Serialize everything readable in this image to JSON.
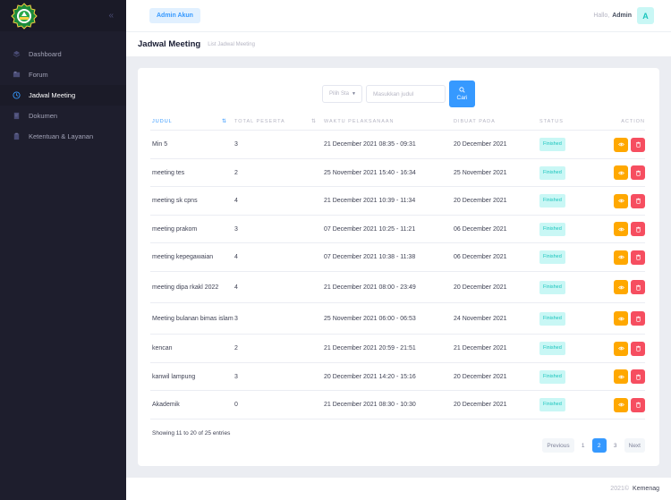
{
  "sidebar": {
    "items": [
      {
        "label": "Dashboard",
        "icon": "layers-icon"
      },
      {
        "label": "Forum",
        "icon": "forum-icon"
      },
      {
        "label": "Jadwal Meeting",
        "icon": "clock-icon",
        "active": true
      },
      {
        "label": "Dokumen",
        "icon": "document-icon"
      },
      {
        "label": "Ketentuan & Layanan",
        "icon": "clipboard-icon"
      }
    ]
  },
  "header": {
    "admin_chip": "Admin Akun",
    "greeting": "Hallo,",
    "user_name": "Admin",
    "avatar_letter": "A"
  },
  "subheader": {
    "title": "Jadwal Meeting",
    "crumb": "List Jadwal Meeting"
  },
  "filters": {
    "status_select": "Pilih Sta",
    "search_placeholder": "Masukkan judul",
    "search_button": "Cari"
  },
  "table": {
    "columns": [
      "JUDUL",
      "TOTAL PESERTA",
      "WAKTU PELAKSANAAN",
      "DIBUAT PADA",
      "STATUS",
      "ACTION"
    ],
    "rows": [
      {
        "judul": "Min 5",
        "peserta": "3",
        "waktu": "21 December 2021 08:35 - 09:31",
        "dibuat": "20 December 2021",
        "status": "Finished"
      },
      {
        "judul": "meeting tes",
        "peserta": "2",
        "waktu": "25 November 2021 15:40 - 16:34",
        "dibuat": "25 November 2021",
        "status": "Finished"
      },
      {
        "judul": "meeting sk cpns",
        "peserta": "4",
        "waktu": "21 December 2021 10:39 - 11:34",
        "dibuat": "20 December 2021",
        "status": "Finished"
      },
      {
        "judul": "meeting prakom",
        "peserta": "3",
        "waktu": "07 December 2021 10:25 - 11:21",
        "dibuat": "06 December 2021",
        "status": "Finished"
      },
      {
        "judul": "meeting kepegawaian",
        "peserta": "4",
        "waktu": "07 December 2021 10:38 - 11:38",
        "dibuat": "06 December 2021",
        "status": "Finished"
      },
      {
        "judul": "meeting dipa rkakl 2022",
        "peserta": "4",
        "waktu": "21 December 2021 08:00 - 23:49",
        "dibuat": "20 December 2021",
        "status": "Finished"
      },
      {
        "judul": "Meeting bulanan bimas islam",
        "peserta": "3",
        "waktu": "25 November 2021 06:00 - 06:53",
        "dibuat": "24 November 2021",
        "status": "Finished"
      },
      {
        "judul": "kencan",
        "peserta": "2",
        "waktu": "21 December 2021 20:59 - 21:51",
        "dibuat": "21 December 2021",
        "status": "Finished"
      },
      {
        "judul": "kanwil lampung",
        "peserta": "3",
        "waktu": "20 December 2021 14:20 - 15:16",
        "dibuat": "20 December 2021",
        "status": "Finished"
      },
      {
        "judul": "Akademik",
        "peserta": "0",
        "waktu": "21 December 2021 08:30 - 10:30",
        "dibuat": "20 December 2021",
        "status": "Finished"
      }
    ]
  },
  "entries_info": "Showing 11 to 20 of 25 entries",
  "pagination": {
    "previous": "Previous",
    "pages": [
      "1",
      "2",
      "3"
    ],
    "current": "2",
    "next": "Next"
  },
  "footer": {
    "year": "2021©",
    "org": "Kemenag"
  },
  "colors": {
    "primary": "#3699ff",
    "sidebar_bg": "#1e1e2d",
    "finished_badge": "#1bc5bd",
    "view_button": "#ffa800",
    "delete_button": "#f64e60"
  }
}
